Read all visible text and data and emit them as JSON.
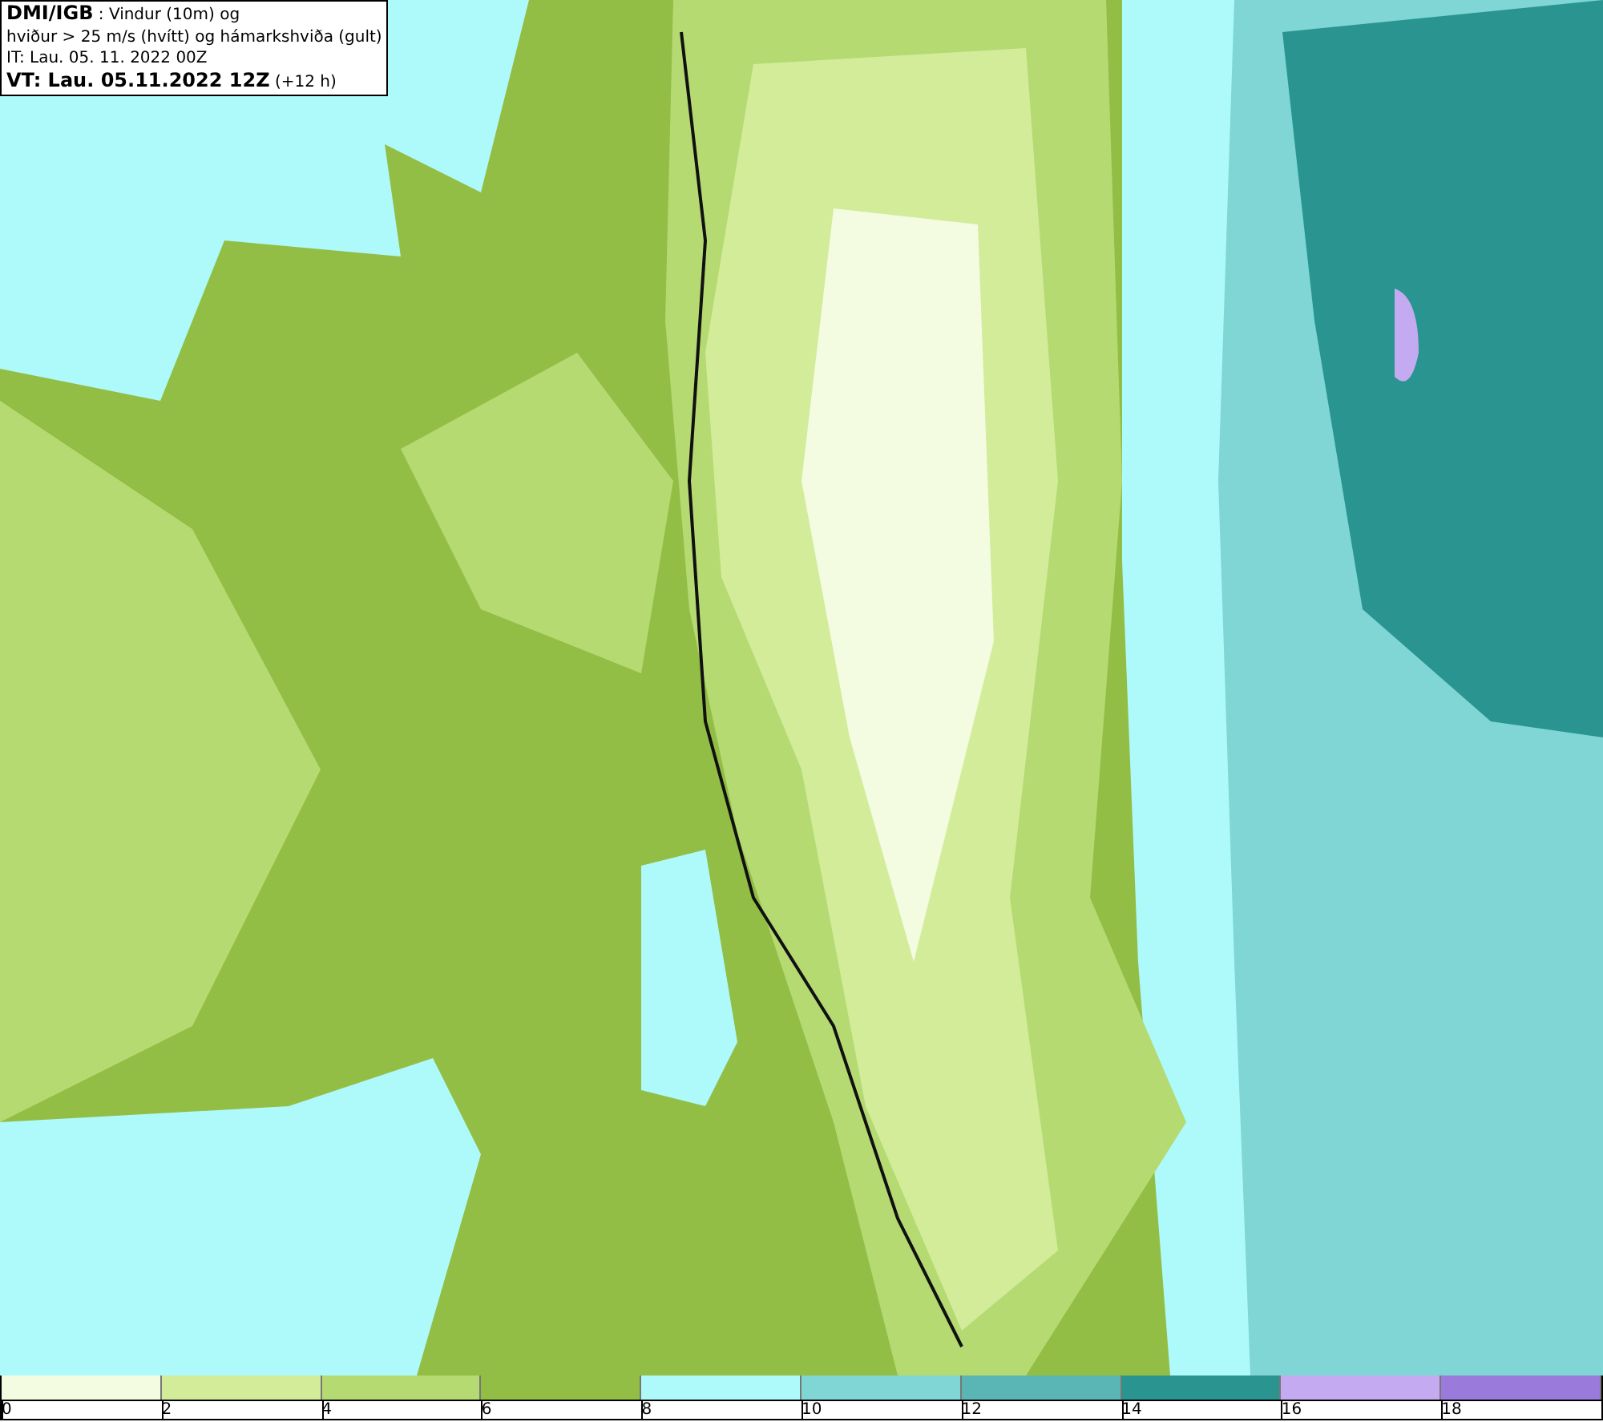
{
  "info_box": {
    "lines": [
      "**DMI/IGB** : Vindur (10m) og",
      "hviður > 25 m/s (hvítt) og hámarkshviða (gult)",
      "IT: Lau. 05. 11. 2022 00Z",
      "**VT: Lau. 05.11.2022 12Z** (+12 h)"
    ]
  },
  "legend": {
    "bins": [
      {
        "color": "#f3fbe0"
      },
      {
        "color": "#d2ec9a"
      },
      {
        "color": "#b5da72"
      },
      {
        "color": "#93be45"
      },
      {
        "color": "#aefafa"
      },
      {
        "color": "#7fd6d4"
      },
      {
        "color": "#5ab6b4"
      },
      {
        "color": "#2a9590"
      },
      {
        "color": "#c4aaf0"
      },
      {
        "color": "#9a7bdc"
      }
    ],
    "ticks": [
      "0",
      "2",
      "4",
      "6",
      "8",
      "10",
      "12",
      "14",
      "16",
      "18"
    ]
  }
}
